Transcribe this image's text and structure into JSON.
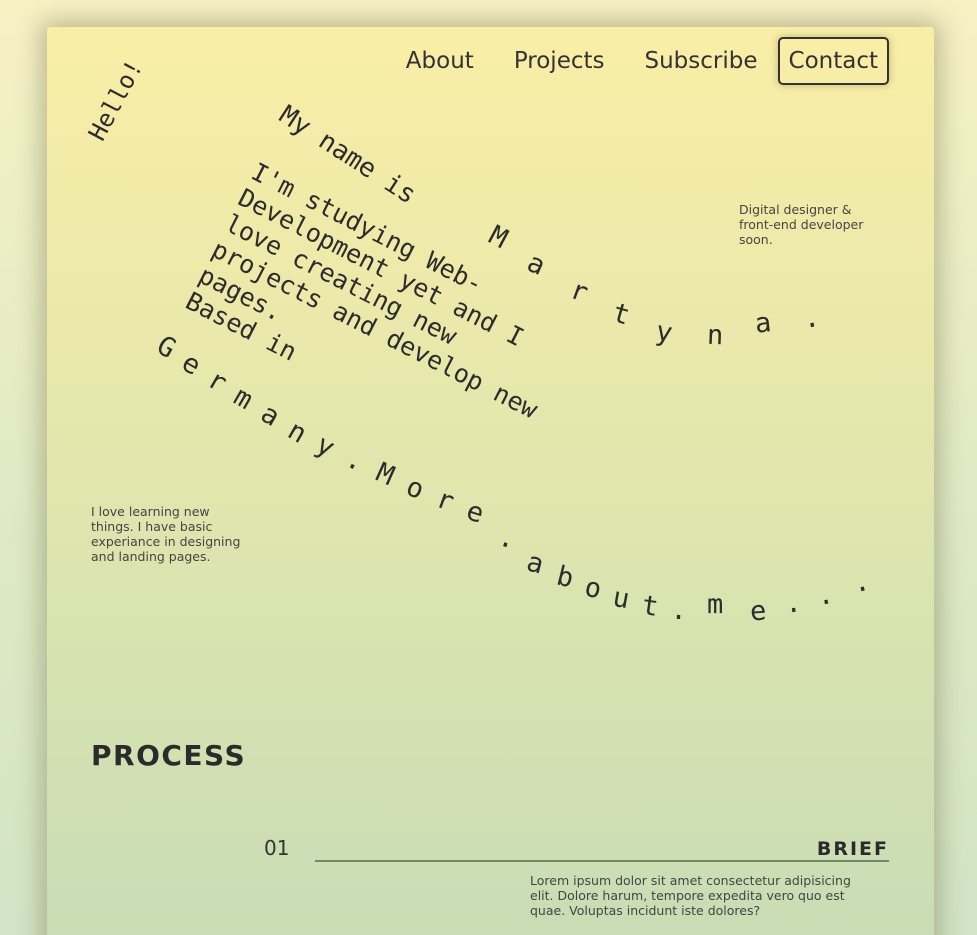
{
  "nav": {
    "about": "About",
    "projects": "Projects",
    "subscribe": "Subscribe",
    "contact": "Contact"
  },
  "hero": {
    "hello": "Hello!",
    "name_intro": "My name is",
    "name_letters": [
      "M",
      "a",
      "r",
      "t",
      "y",
      "n",
      "a",
      "."
    ],
    "bio": "I'm studying Web-\nDevelopment yet and I\nlove creating new\nprojects and develop new\npages.\nBased in",
    "trail_letters": [
      "G",
      "e",
      "r",
      "m",
      "a",
      "n",
      "y",
      ".",
      "M",
      "o",
      "r",
      "e",
      ".",
      "a",
      "b",
      "o",
      "u",
      "t",
      ".",
      "m",
      "e",
      ".",
      ".",
      "."
    ],
    "tagline": "Digital designer & front-end developer soon.",
    "learning": "I love learning new things. I have basic experiance in designing and landing pages."
  },
  "process": {
    "title": "PROCESS",
    "steps": [
      {
        "number": "01",
        "title": "BRIEF",
        "description": "Lorem ipsum dolor sit amet consectetur adipisicing elit. Dolore harum, tempore expedita vero quo est quae. Voluptas incidunt iste dolores?"
      }
    ]
  }
}
